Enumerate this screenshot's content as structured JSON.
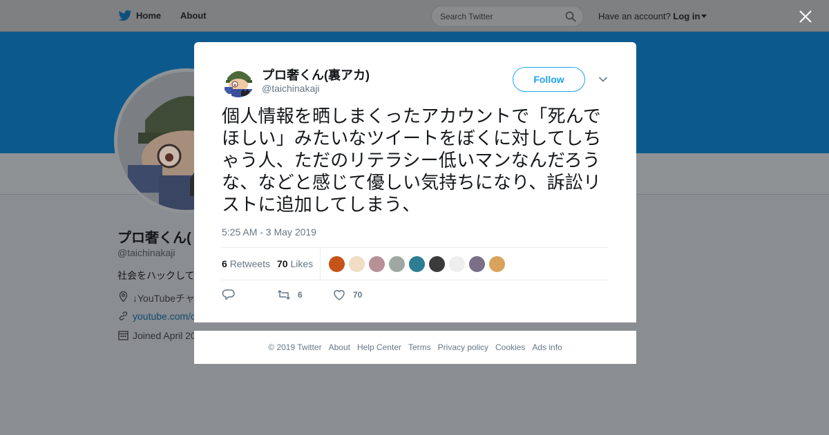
{
  "topbar": {
    "nav": [
      {
        "label": "Home"
      },
      {
        "label": "About"
      }
    ],
    "search_placeholder": "Search Twitter",
    "account_prompt": "Have an account?",
    "login_label": "Log in"
  },
  "profile": {
    "name": "プロ奢くん(",
    "handle": "@taichinakaji",
    "bio": "社会をハックして",
    "location": "↓YouTubeチャ",
    "link": "youtube.com/c",
    "joined": "Joined April 20"
  },
  "tweet": {
    "author_name": "プロ奢くん(裏アカ)",
    "author_handle": "@taichinakaji",
    "follow_label": "Follow",
    "text": "個人情報を晒しまくったアカウントで「死んでほしい」みたいなツイートをぼくに対してしちゃう人、ただのリテラシー低いマンなんだろうな、などと感じて優しい気持ちになり、訴訟リストに追加してしまう、",
    "timestamp": "5:25 AM - 3 May 2019",
    "retweet_count": "6",
    "retweets_label": "Retweets",
    "like_count": "70",
    "likes_label": "Likes",
    "action_retweet_count": "6",
    "action_like_count": "70",
    "liker_colors": [
      "#c5531a",
      "#f1dcc4",
      "#b89098",
      "#9fa7a3",
      "#2d7d93",
      "#3b3b3b",
      "#eeeeee",
      "#7a6f86",
      "#d9a35b"
    ]
  },
  "footer": {
    "links": [
      "© 2019 Twitter",
      "About",
      "Help Center",
      "Terms",
      "Privacy policy",
      "Cookies",
      "Ads info"
    ]
  },
  "colors": {
    "accent": "#1da1f2",
    "banner": "#1b9ae6",
    "overlay": "#8a8d91"
  }
}
